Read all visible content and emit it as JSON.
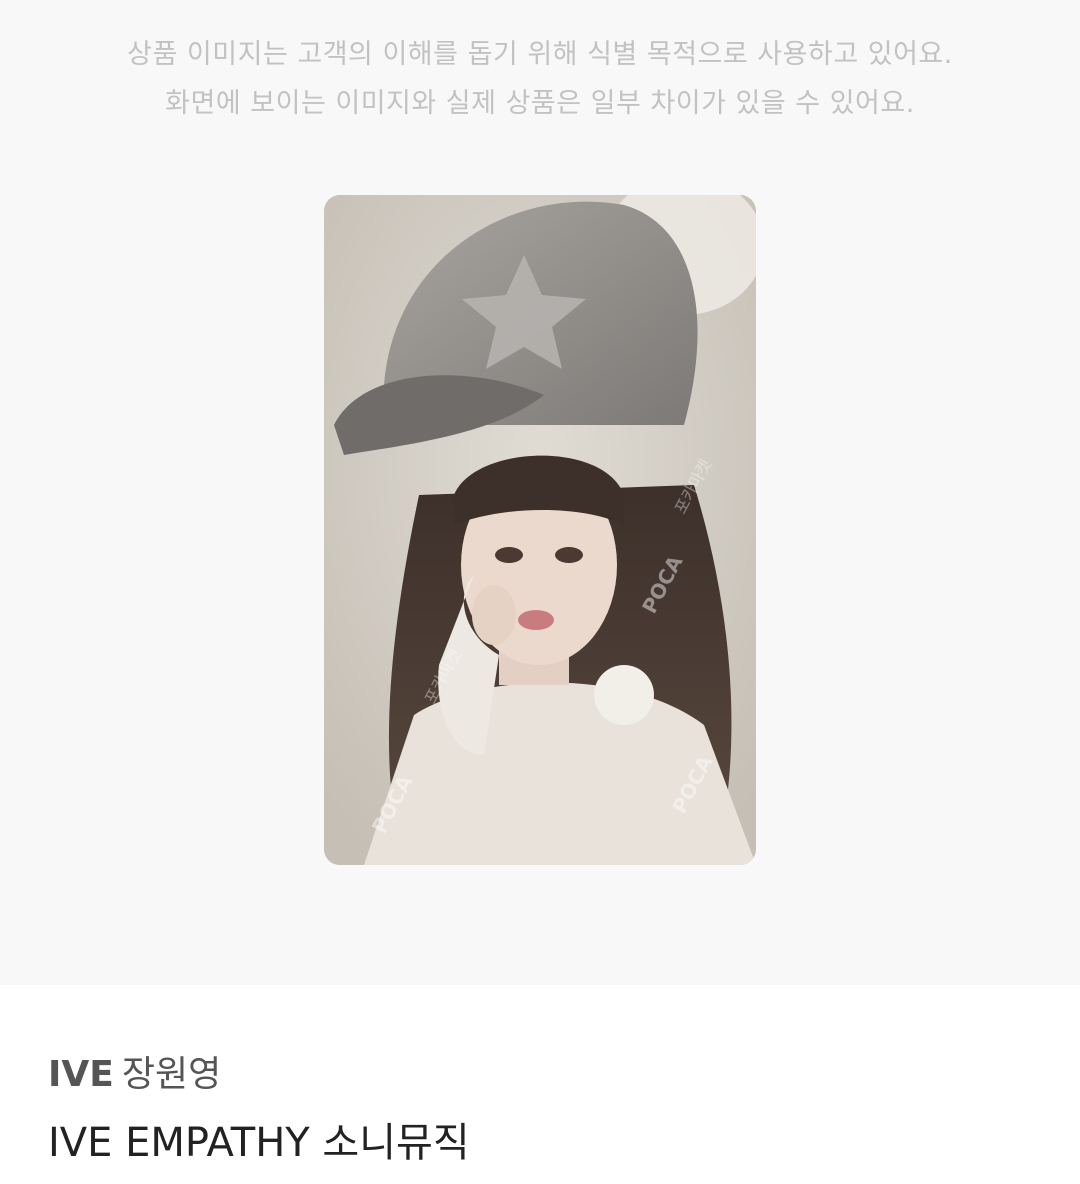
{
  "notice": {
    "line1": "상품 이미지는 고객의 이해를 돕기 위해 식별 목적으로 사용하고 있어요.",
    "line2": "화면에 보이는 이미지와 실제 상품은 일부 차이가 있을 수 있어요."
  },
  "photo": {
    "watermark_brand": "POCA",
    "watermark_text": "포카마켓",
    "colors": {
      "background": "#d6d1c8",
      "hat": "#8e8b88",
      "hair": "#4a3c34",
      "skin": "#ead7cc",
      "sweater": "#ece7e1"
    }
  },
  "product": {
    "group": "IVE",
    "member": "장원영",
    "title": "IVE EMPATHY 소니뮤직"
  }
}
